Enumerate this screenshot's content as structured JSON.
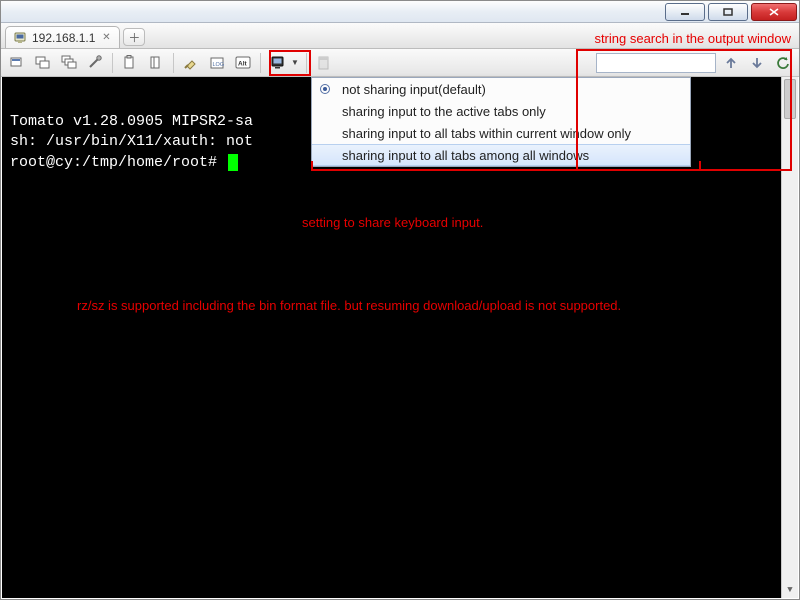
{
  "tab": {
    "ip": "192.168.1.1"
  },
  "annotations": {
    "search_hint": "string search in the output window",
    "share_hint": "setting to share keyboard input.",
    "rzsz": "rz/sz is supported including the bin format file. but resuming download/upload is not supported."
  },
  "menu": {
    "items": [
      "not sharing input(default)",
      "sharing input to the active tabs only",
      "sharing input to all tabs within current window only",
      "sharing input to all tabs among all windows"
    ],
    "selected_index": 0,
    "hovered_index": 3
  },
  "terminal": {
    "line1": "Tomato v1.28.0905 MIPSR2-sa",
    "line2": "sh: /usr/bin/X11/xauth: not",
    "prompt": "root@cy:/tmp/home/root# "
  },
  "search": {
    "value": "",
    "placeholder": ""
  },
  "colors": {
    "accent_red": "#e60000",
    "cursor_green": "#00ff00"
  }
}
